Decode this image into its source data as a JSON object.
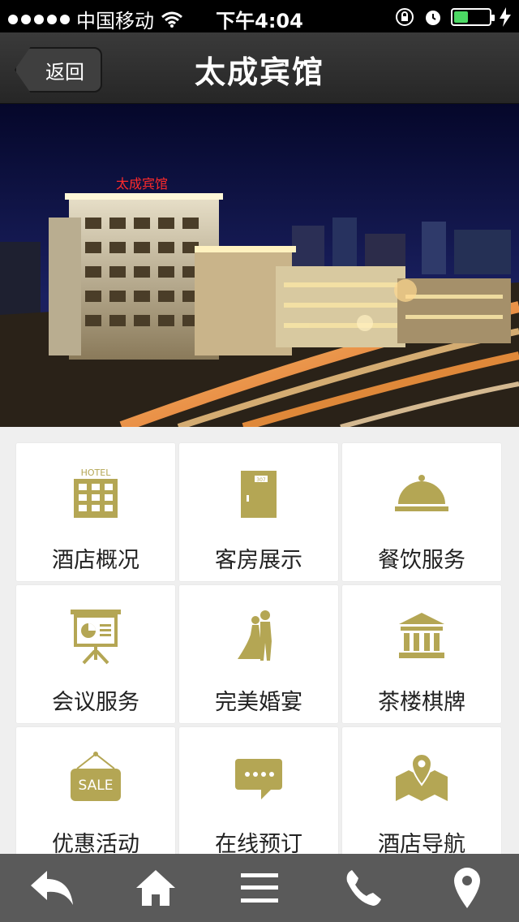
{
  "status_bar": {
    "carrier": "中国移动",
    "time": "下午4:04",
    "battery_level": 0.4,
    "icons": [
      "signal-dots",
      "wifi-icon",
      "orientation-lock-icon",
      "alarm-icon",
      "battery-icon",
      "charging-icon"
    ]
  },
  "navbar": {
    "back_label": "返回",
    "title": "太成宾馆"
  },
  "hero": {
    "sign_text": "太成宾馆"
  },
  "grid": {
    "accent_color": "#b4a654",
    "items": [
      {
        "label": "酒店概况",
        "icon": "hotel-building-icon",
        "icon_text": "HOTEL"
      },
      {
        "label": "客房展示",
        "icon": "room-door-icon",
        "icon_text": "307"
      },
      {
        "label": "餐饮服务",
        "icon": "food-cloche-icon"
      },
      {
        "label": "会议服务",
        "icon": "presentation-board-icon"
      },
      {
        "label": "完美婚宴",
        "icon": "wedding-couple-icon"
      },
      {
        "label": "茶楼棋牌",
        "icon": "building-columns-icon"
      },
      {
        "label": "优惠活动",
        "icon": "sale-sign-icon",
        "icon_text": "SALE"
      },
      {
        "label": "在线预订",
        "icon": "chat-bubble-icon"
      },
      {
        "label": "酒店导航",
        "icon": "map-pin-icon"
      }
    ]
  },
  "footer": {
    "background": "#5a5a5a",
    "items": [
      {
        "icon": "reply-back-icon"
      },
      {
        "icon": "home-icon"
      },
      {
        "icon": "menu-icon"
      },
      {
        "icon": "phone-icon"
      },
      {
        "icon": "location-pin-icon"
      }
    ]
  }
}
